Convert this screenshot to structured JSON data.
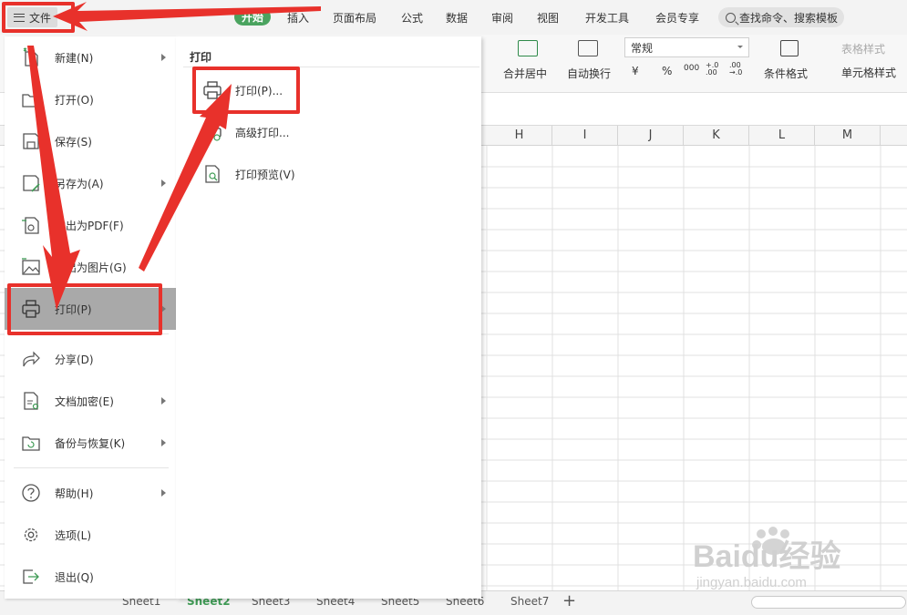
{
  "menubar": {
    "file_label": "文件",
    "tabs": [
      "开始",
      "插入",
      "页面布局",
      "公式",
      "数据",
      "审阅",
      "视图",
      "开发工具",
      "会员专享"
    ],
    "search_placeholder": "查找命令、搜索模板"
  },
  "ribbon": {
    "merge_label": "合并居中",
    "wrap_label": "自动换行",
    "number_format": "常规",
    "currency_symbol": "¥",
    "percent_symbol": "%",
    "thousands_symbol": "000",
    "inc_decimal": "+.0 .00",
    "dec_decimal": ".00 →.0",
    "cond_format_label": "条件格式",
    "table_style_label": "表格样式",
    "cell_style_label": "单元格样式"
  },
  "grid": {
    "columns": [
      "H",
      "I",
      "J",
      "K",
      "L",
      "M"
    ]
  },
  "file_menu": {
    "items": [
      {
        "label": "新建(N)",
        "icon": "new-file-icon",
        "submenu": true
      },
      {
        "label": "打开(O)",
        "icon": "open-folder-icon",
        "submenu": false
      },
      {
        "label": "保存(S)",
        "icon": "save-icon",
        "submenu": false
      },
      {
        "label": "另存为(A)",
        "icon": "save-as-icon",
        "submenu": true
      },
      {
        "label": "输出为PDF(F)",
        "icon": "export-pdf-icon",
        "submenu": false
      },
      {
        "label": "输出为图片(G)",
        "icon": "export-image-icon",
        "submenu": false
      },
      {
        "label": "打印(P)",
        "icon": "printer-icon",
        "submenu": true,
        "active": true
      },
      {
        "label": "分享(D)",
        "icon": "share-icon",
        "submenu": false
      },
      {
        "label": "文档加密(E)",
        "icon": "encrypt-document-icon",
        "submenu": true
      },
      {
        "label": "备份与恢复(K)",
        "icon": "backup-restore-icon",
        "submenu": true
      },
      {
        "label": "帮助(H)",
        "icon": "help-icon",
        "submenu": true
      },
      {
        "label": "选项(L)",
        "icon": "settings-gear-icon",
        "submenu": false
      },
      {
        "label": "退出(Q)",
        "icon": "exit-icon",
        "submenu": false
      }
    ]
  },
  "print_submenu": {
    "title": "打印",
    "items": [
      {
        "label": "打印(P)...",
        "icon": "printer-icon"
      },
      {
        "label": "高级打印...",
        "icon": "advanced-print-icon"
      },
      {
        "label": "打印预览(V)",
        "icon": "print-preview-icon"
      }
    ]
  },
  "sheets": {
    "tabs": [
      "Sheet1",
      "Sheet2",
      "Sheet3",
      "Sheet4",
      "Sheet5",
      "Sheet6",
      "Sheet7"
    ],
    "active_index": 1
  },
  "watermark": {
    "brand": "Baidu经验",
    "url": "jingyan.baidu.com"
  },
  "colors": {
    "accent_green": "#4aa35f",
    "highlight_red": "#e8312b",
    "active_menu_gray": "#a9a9a9"
  }
}
